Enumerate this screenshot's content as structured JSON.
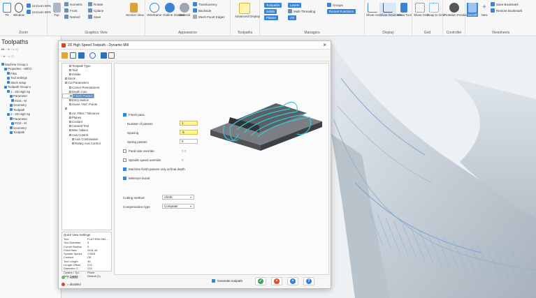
{
  "ribbon": {
    "zoom_group": {
      "label": "Zoom",
      "fit": "Fit",
      "window": "Window",
      "unzoom50": "Unzoom 50%",
      "unzoom80": "Unzoom 80%"
    },
    "graphics_view_group": {
      "label": "Graphics View",
      "top": "Top",
      "front": "Front",
      "named": "Named",
      "isometric": "Isometric",
      "rotate": "Rotate",
      "cplane": "Cplane",
      "save": "Save",
      "section_view": "Section View"
    },
    "appearance_group": {
      "label": "Appearance",
      "wireframe": "Wireframe",
      "outline_shaded": "Outline Shaded",
      "material": "Material",
      "translucency": "Translucency",
      "backside": "Backside",
      "mesh_facet_edges": "Mesh Facet Edges"
    },
    "toolpaths_group": {
      "label": "Toolpaths",
      "advanced_display": "Advanced Display"
    },
    "managers_group": {
      "label": "Managers",
      "toolpaths": "Toolpaths",
      "levels": "Levels",
      "groups": "Groups",
      "solids": "Solids",
      "multi_threading": "Multi-Threading",
      "recent_functions": "Recent Functions",
      "planes": "Planes",
      "art": "Art"
    },
    "display_group": {
      "label": "Display",
      "show_axes": "Show Axes",
      "show_gnomons": "Show Gnomons",
      "show_tool": "Show Tool"
    },
    "grid_group": {
      "label": "Grid",
      "show_grid": "Show Grid",
      "snap_to_grid": "Snap to Grid"
    },
    "controller_group": {
      "label": "Controller",
      "rotation_position": "Rotation Position"
    },
    "viewsheets_group": {
      "label": "Viewsheets",
      "on_off": "On/Off",
      "new": "New",
      "save_bookmark": "Save Bookmark",
      "restore_bookmark": "Restore Bookmark"
    }
  },
  "left_panel": {
    "title": "Toolpaths",
    "tree": [
      "Machine Group-1",
      "Properties - Mill D",
      "Files",
      "Tool settings",
      "Stock setup",
      "Toolpath Group-1",
      "1 - 2D High Sp",
      "Parameter",
      "#215 - M",
      "Geometry",
      "Toolpath",
      "2 - 2D High Sp",
      "Parameter",
      "#215 - M",
      "Geometry",
      "Toolpath"
    ]
  },
  "dialog": {
    "title": "2D High Speed Toolpath - Dynamic Mill",
    "close_glyph": "×",
    "tree": [
      {
        "label": "Toolpath Type",
        "selected": false
      },
      {
        "label": "Tool",
        "selected": false
      },
      {
        "label": "Holder",
        "selected": false
      },
      {
        "label": "Stock",
        "selected": false
      },
      {
        "label": "Cut Parameters",
        "selected": false
      },
      {
        "label": "Corner Pretreatment",
        "selected": false
      },
      {
        "label": "Depth Cuts",
        "selected": false
      },
      {
        "label": "Finish Passes",
        "selected": true
      },
      {
        "label": "Linking Parameters",
        "selected": false
      },
      {
        "label": "Entry Motion",
        "selected": false
      },
      {
        "label": "Home / Ref. Points",
        "selected": false
      },
      {
        "label": "",
        "selected": false
      },
      {
        "label": "Arc Filter / Tolerance",
        "selected": false
      },
      {
        "label": "Planes",
        "selected": false
      },
      {
        "label": "Coolant",
        "selected": false
      },
      {
        "label": "Canned Text",
        "selected": false
      },
      {
        "label": "Misc Values",
        "selected": false
      },
      {
        "label": "Axis Control",
        "selected": false
      },
      {
        "label": "Axis Combination",
        "selected": false
      },
      {
        "label": "Rotary Axis Control",
        "selected": false
      }
    ],
    "quick_view": {
      "title": "Quick View Settings",
      "rows": [
        {
          "k": "Tool",
          "v": "FLAT END MIL..."
        },
        {
          "k": "Tool Diameter",
          "v": "5"
        },
        {
          "k": "Corner Radius",
          "v": "0"
        },
        {
          "k": "Feed Rate",
          "v": "3151.46"
        },
        {
          "k": "Spindle Speed",
          "v": "17825"
        },
        {
          "k": "Coolant",
          "v": "Off"
        },
        {
          "k": "Tool Length",
          "v": "45"
        },
        {
          "k": "Length Offset",
          "v": "215"
        },
        {
          "k": "Diameter O...",
          "v": "215"
        },
        {
          "k": "Cplane / Tpl...",
          "v": "Plane"
        },
        {
          "k": "Axis Combi...",
          "v": "Default (1)"
        }
      ]
    },
    "legend": {
      "edited": "= edited",
      "disabled": "= disabled"
    },
    "finish_pass": {
      "label": "Finish pass",
      "number_of_passes_label": "Number of passes",
      "number_of_passes_value": "1",
      "spacing_label": "Spacing",
      "spacing_value": ".5",
      "spring_passes_label": "Spring passes",
      "spring_passes_value": "0",
      "feed_rate_override_label": "Feed rate override",
      "feed_rate_override_value": "0.0",
      "spindle_speed_override_label": "Spindle speed override",
      "spindle_speed_override_value": "0",
      "machine_finish_label": "Machine finish passes only at final depth",
      "minimize_burial_label": "Minimize burial",
      "cutting_method_label": "Cutting method",
      "cutting_method_value": "Climb",
      "compensation_type_label": "Compensation type",
      "compensation_type_value": "Computer"
    },
    "generate_toolpath_label": "Generate toolpath",
    "colors": {
      "ok": "#3aa55a",
      "cancel": "#e0442a",
      "add": "#2f7fd6",
      "help": "#2f7fd6"
    }
  }
}
